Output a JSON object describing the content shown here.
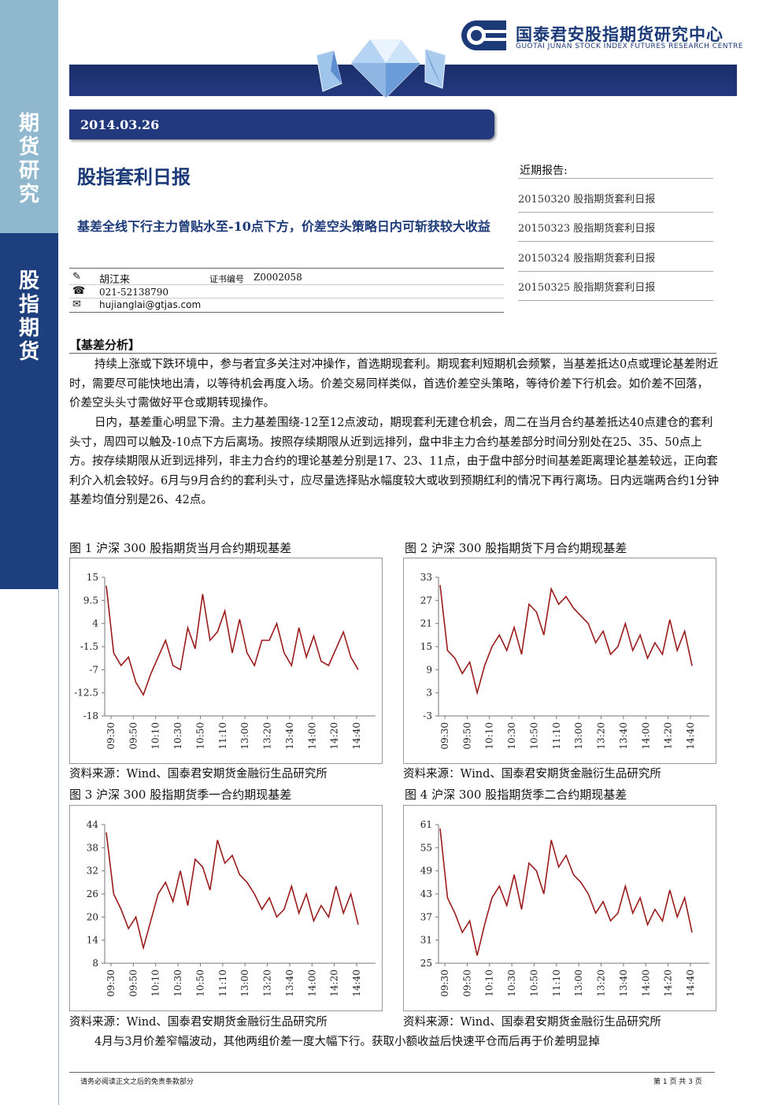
{
  "sidebar": {
    "top_label": [
      "期",
      "货",
      "研",
      "究"
    ],
    "bottom_label": [
      "股",
      "指",
      "期",
      "货"
    ]
  },
  "brand": {
    "name_cn": "国泰君安股指期货研究中心",
    "name_en": "GUOTAI JUNAN STOCK INDEX FUTURES RESEARCH CENTRE"
  },
  "colors": {
    "navy": "#22397e",
    "sky": "#8fb8cf",
    "line": "#9b1b1b"
  },
  "report": {
    "date": "2014.03.26",
    "title": "股指套利日报",
    "subtitle": "基差全线下行主力曾贴水至-10点下方，价差空头策略日内可斩获较大收益"
  },
  "author": {
    "name": "胡江来",
    "cert_label": "证书编号",
    "cert_no": "Z0002058",
    "phone": "021-52138790",
    "email": "hujianglai@gtjas.com",
    "icons": [
      "pen-icon",
      "phone-icon",
      "mail-icon"
    ]
  },
  "recent": {
    "heading": "近期报告:",
    "items": [
      "20150320 股指期货套利日报",
      "20150323 股指期货套利日报",
      "20150324 股指期货套利日报",
      "20150325 股指期货套利日报"
    ]
  },
  "section": {
    "heading": "【基差分析】",
    "p1": "持续上涨或下跌环境中，参与者宜多关注对冲操作，首选期现套利。期现套利短期机会频繁，当基差抵达0点或理论基差附近时，需要尽可能快地出清，以等待机会再度入场。价差交易同样类似，首选价差空头策略，等待价差下行机会。如价差不回落，价差空头头寸需做好平仓或期转现操作。",
    "p2": "日内，基差重心明显下滑。主力基差围绕-12至12点波动，期现套利无建仓机会，周二在当月合约基差抵达40点建仓的套利头寸，周四可以触及-10点下方后离场。按照存续期限从近到远排列，盘中非主力合约基差部分时间分别处在25、35、50点上方。按存续期限从近到远排列，非主力合约的理论基差分别是17、23、11点，由于盘中部分时间基差距离理论基差较远，正向套利介入机会较好。6月与9月合约的套利头寸，应尽量选择贴水幅度较大或收到预期红利的情况下再行离场。日内远端两合约1分钟基差均值分别是26、42点。",
    "p3": "4月与3月价差窄幅波动，其他两组价差一度大幅下行。获取小额收益后快速平仓而后再于价差明显掉"
  },
  "figures": {
    "source": "资料来源：Wind、国泰君安期货金融衍生品研究所",
    "titles": [
      "图 1 沪深 300 股指期货当月合约期现基差",
      "图 2 沪深 300 股指期货下月合约期现基差",
      "图 3 沪深 300 股指期货季一合约期现基差",
      "图 4 沪深 300 股指期货季二合约期现基差"
    ]
  },
  "chart_data": [
    {
      "type": "line",
      "x": [
        "09:30",
        "09:50",
        "10:10",
        "10:30",
        "10:50",
        "11:10",
        "13:00",
        "13:20",
        "13:40",
        "14:00",
        "14:20",
        "14:40"
      ],
      "yticks": [
        "15",
        "9.5",
        "4",
        "-1.5",
        "-7",
        "-12.5",
        "-18"
      ],
      "ylim": [
        -18,
        15
      ],
      "grid": false,
      "series": [
        {
          "values": [
            13,
            -3,
            -6,
            -4,
            -10,
            -13,
            -8,
            -4,
            0,
            -6,
            -7,
            3,
            -2,
            11,
            0,
            2,
            7,
            -3,
            5,
            -3,
            -6,
            0,
            0,
            4,
            -3,
            -6,
            3,
            -4,
            1,
            -5,
            -6,
            -2,
            2,
            -4,
            -7
          ]
        }
      ]
    },
    {
      "type": "line",
      "x": [
        "09:30",
        "09:50",
        "10:10",
        "10:30",
        "10:50",
        "11:10",
        "13:00",
        "13:20",
        "13:40",
        "14:00",
        "14:20",
        "14:40"
      ],
      "yticks": [
        "33",
        "27",
        "21",
        "15",
        "9",
        "3",
        "-3"
      ],
      "ylim": [
        -3,
        33
      ],
      "grid": false,
      "series": [
        {
          "values": [
            31,
            14,
            12,
            8,
            11,
            3,
            10,
            15,
            18,
            14,
            20,
            13,
            26,
            24,
            18,
            30,
            26,
            28,
            25,
            23,
            21,
            16,
            19,
            13,
            15,
            21,
            14,
            18,
            12,
            16,
            13,
            22,
            14,
            19,
            10
          ]
        }
      ]
    },
    {
      "type": "line",
      "x": [
        "09:30",
        "09:50",
        "10:10",
        "10:30",
        "10:50",
        "11:10",
        "13:00",
        "13:20",
        "13:40",
        "14:00",
        "14:20",
        "14:40"
      ],
      "yticks": [
        "44",
        "38",
        "32",
        "26",
        "20",
        "14",
        "8"
      ],
      "ylim": [
        8,
        44
      ],
      "grid": false,
      "series": [
        {
          "values": [
            42,
            26,
            22,
            17,
            20,
            12,
            19,
            26,
            29,
            24,
            32,
            23,
            35,
            33,
            27,
            40,
            34,
            36,
            31,
            29,
            26,
            22,
            25,
            20,
            22,
            28,
            21,
            26,
            19,
            23,
            20,
            28,
            21,
            26,
            18
          ]
        }
      ]
    },
    {
      "type": "line",
      "x": [
        "09:30",
        "09:50",
        "10:10",
        "10:30",
        "10:50",
        "11:10",
        "13:00",
        "13:20",
        "13:40",
        "14:00",
        "14:20",
        "14:40"
      ],
      "yticks": [
        "61",
        "55",
        "49",
        "43",
        "37",
        "31",
        "25"
      ],
      "ylim": [
        25,
        61
      ],
      "grid": false,
      "series": [
        {
          "values": [
            60,
            42,
            38,
            33,
            36,
            27,
            35,
            42,
            45,
            40,
            48,
            39,
            51,
            49,
            43,
            57,
            50,
            53,
            48,
            46,
            43,
            38,
            41,
            36,
            38,
            45,
            38,
            42,
            35,
            39,
            36,
            44,
            37,
            42,
            33
          ]
        }
      ]
    }
  ],
  "footer": {
    "disclaimer": "请务必阅读正文之后的免责条款部分",
    "page": "第 1 页 共 3 页"
  }
}
